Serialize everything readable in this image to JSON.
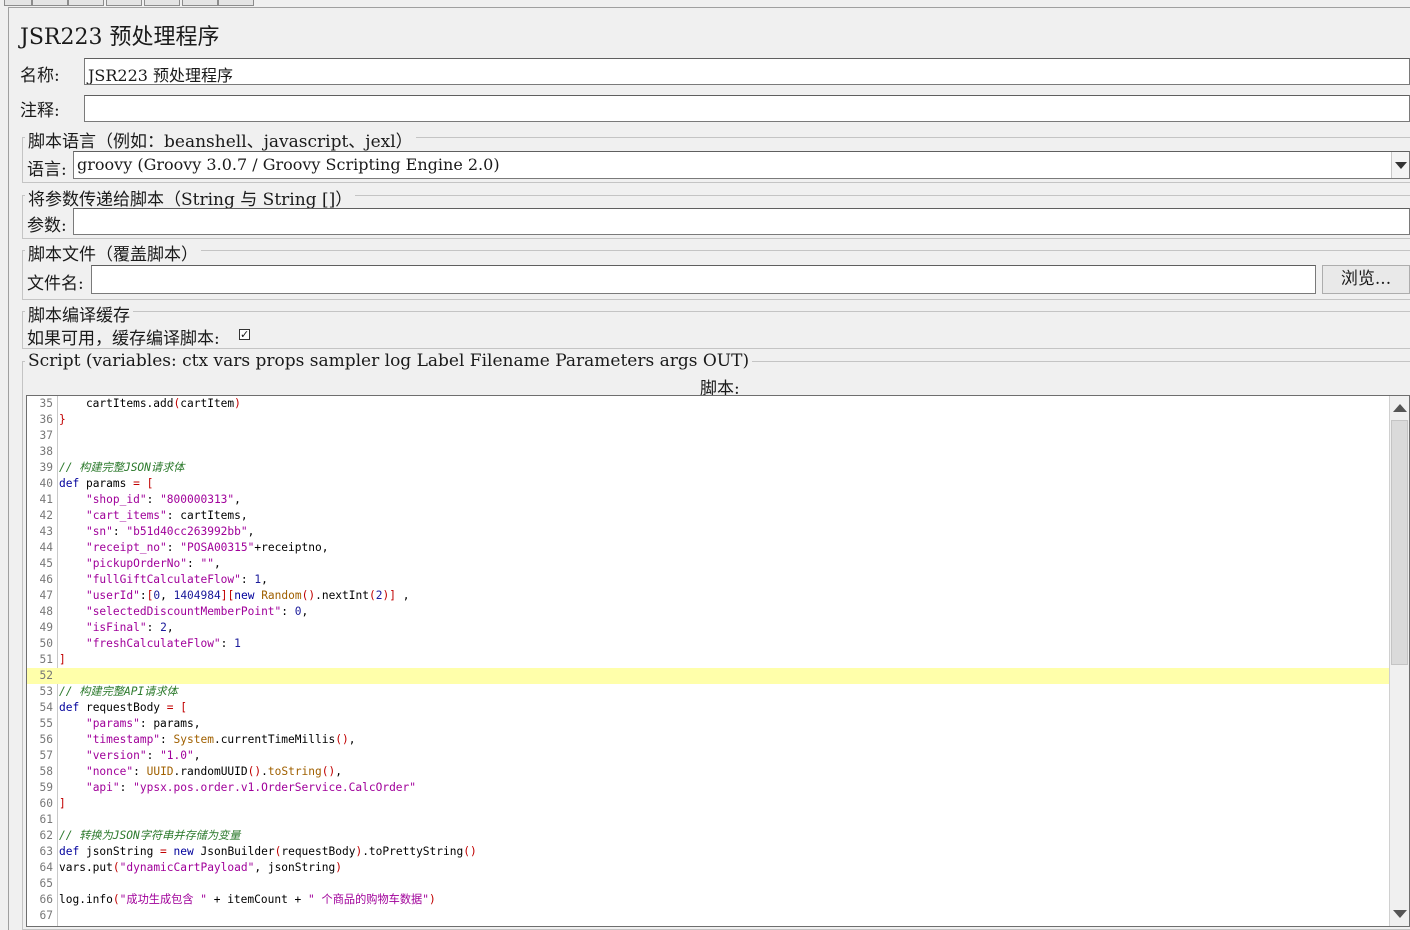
{
  "title": "JSR223 预处理程序",
  "name_label": "名称:",
  "name_value": "JSR223 预处理程序",
  "comment_label": "注释:",
  "comment_value": "",
  "lang_section": "脚本语言（例如：beanshell、javascript、jexl）",
  "lang_label": "语言:",
  "lang_value": "groovy      (Groovy 3.0.7 / Groovy Scripting Engine 2.0)",
  "params_section": "将参数传递给脚本（String 与 String []）",
  "params_label": "参数:",
  "params_value": "",
  "file_section": "脚本文件（覆盖脚本）",
  "file_label": "文件名:",
  "file_value": "",
  "browse_button": "浏览...",
  "cache_section": "脚本编译缓存",
  "cache_label": "如果可用，缓存编译脚本:",
  "cache_checked": true,
  "script_section": "Script (variables: ctx vars props sampler log Label Filename Parameters args OUT)",
  "script_caption": "脚本:",
  "highlighted_line": 52,
  "code_lines": [
    {
      "n": "35",
      "tokens": [
        [
          "",
          "    cartItems.add"
        ],
        [
          "br",
          "("
        ],
        [
          "",
          "cartItem"
        ],
        [
          "br",
          ")"
        ]
      ]
    },
    {
      "n": "36",
      "tokens": [
        [
          "br",
          "}"
        ]
      ]
    },
    {
      "n": "37",
      "tokens": []
    },
    {
      "n": "38",
      "tokens": []
    },
    {
      "n": "39",
      "tokens": [
        [
          "cm",
          "// 构建完整JSON请求体"
        ]
      ]
    },
    {
      "n": "40",
      "tokens": [
        [
          "kw",
          "def"
        ],
        [
          "",
          " params "
        ],
        [
          "br",
          "="
        ],
        [
          "",
          " "
        ],
        [
          "br",
          "["
        ]
      ]
    },
    {
      "n": "41",
      "tokens": [
        [
          "",
          "    "
        ],
        [
          "str",
          "\"shop_id\""
        ],
        [
          "",
          ": "
        ],
        [
          "str",
          "\"800000313\""
        ],
        [
          "",
          ","
        ]
      ]
    },
    {
      "n": "42",
      "tokens": [
        [
          "",
          "    "
        ],
        [
          "str",
          "\"cart_items\""
        ],
        [
          "",
          ": cartItems,"
        ]
      ]
    },
    {
      "n": "43",
      "tokens": [
        [
          "",
          "    "
        ],
        [
          "str",
          "\"sn\""
        ],
        [
          "",
          ": "
        ],
        [
          "str",
          "\"b51d40cc263992bb\""
        ],
        [
          "",
          ","
        ]
      ]
    },
    {
      "n": "44",
      "tokens": [
        [
          "",
          "    "
        ],
        [
          "str",
          "\"receipt_no\""
        ],
        [
          "",
          ": "
        ],
        [
          "str",
          "\"POSA00315\""
        ],
        [
          "",
          "+receiptno,"
        ]
      ]
    },
    {
      "n": "45",
      "tokens": [
        [
          "",
          "    "
        ],
        [
          "str",
          "\"pickupOrderNo\""
        ],
        [
          "",
          ": "
        ],
        [
          "str",
          "\"\""
        ],
        [
          "",
          ","
        ]
      ]
    },
    {
      "n": "46",
      "tokens": [
        [
          "",
          "    "
        ],
        [
          "str",
          "\"fullGiftCalculateFlow\""
        ],
        [
          "",
          ": "
        ],
        [
          "num",
          "1"
        ],
        [
          "",
          ","
        ]
      ]
    },
    {
      "n": "47",
      "tokens": [
        [
          "",
          "    "
        ],
        [
          "str",
          "\"userId\""
        ],
        [
          "",
          ":"
        ],
        [
          "br",
          "["
        ],
        [
          "num",
          "0"
        ],
        [
          "",
          ", "
        ],
        [
          "num",
          "1404984"
        ],
        [
          "br",
          "]["
        ],
        [
          "kw",
          "new"
        ],
        [
          "",
          " "
        ],
        [
          "fn",
          "Random"
        ],
        [
          "br",
          "()"
        ],
        [
          "",
          ".nextInt"
        ],
        [
          "br",
          "("
        ],
        [
          "num",
          "2"
        ],
        [
          "br",
          ")]"
        ],
        [
          "",
          " ,"
        ]
      ]
    },
    {
      "n": "48",
      "tokens": [
        [
          "",
          "    "
        ],
        [
          "str",
          "\"selectedDiscountMemberPoint\""
        ],
        [
          "",
          ": "
        ],
        [
          "num",
          "0"
        ],
        [
          "",
          ","
        ]
      ]
    },
    {
      "n": "49",
      "tokens": [
        [
          "",
          "    "
        ],
        [
          "str",
          "\"isFinal\""
        ],
        [
          "",
          ": "
        ],
        [
          "num",
          "2"
        ],
        [
          "",
          ","
        ]
      ]
    },
    {
      "n": "50",
      "tokens": [
        [
          "",
          "    "
        ],
        [
          "str",
          "\"freshCalculateFlow\""
        ],
        [
          "",
          ": "
        ],
        [
          "num",
          "1"
        ]
      ]
    },
    {
      "n": "51",
      "tokens": [
        [
          "br",
          "]"
        ]
      ]
    },
    {
      "n": "52",
      "tokens": []
    },
    {
      "n": "53",
      "tokens": [
        [
          "cm",
          "// 构建完整API请求体"
        ]
      ]
    },
    {
      "n": "54",
      "tokens": [
        [
          "kw",
          "def"
        ],
        [
          "",
          " requestBody "
        ],
        [
          "br",
          "="
        ],
        [
          "",
          " "
        ],
        [
          "br",
          "["
        ]
      ]
    },
    {
      "n": "55",
      "tokens": [
        [
          "",
          "    "
        ],
        [
          "str",
          "\"params\""
        ],
        [
          "",
          ": params,"
        ]
      ]
    },
    {
      "n": "56",
      "tokens": [
        [
          "",
          "    "
        ],
        [
          "str",
          "\"timestamp\""
        ],
        [
          "",
          ": "
        ],
        [
          "fn",
          "System"
        ],
        [
          "",
          ".currentTimeMillis"
        ],
        [
          "br",
          "()"
        ],
        [
          "",
          ","
        ]
      ]
    },
    {
      "n": "57",
      "tokens": [
        [
          "",
          "    "
        ],
        [
          "str",
          "\"version\""
        ],
        [
          "",
          ": "
        ],
        [
          "str",
          "\"1.0\""
        ],
        [
          "",
          ","
        ]
      ]
    },
    {
      "n": "58",
      "tokens": [
        [
          "",
          "    "
        ],
        [
          "str",
          "\"nonce\""
        ],
        [
          "",
          ": "
        ],
        [
          "fn",
          "UUID"
        ],
        [
          "",
          ".randomUUID"
        ],
        [
          "br",
          "()"
        ],
        [
          "",
          "."
        ],
        [
          "fn",
          "toString"
        ],
        [
          "br",
          "()"
        ],
        [
          "",
          ","
        ]
      ]
    },
    {
      "n": "59",
      "tokens": [
        [
          "",
          "    "
        ],
        [
          "str",
          "\"api\""
        ],
        [
          "",
          ": "
        ],
        [
          "str",
          "\"ypsx.pos.order.v1.OrderService.CalcOrder\""
        ]
      ]
    },
    {
      "n": "60",
      "tokens": [
        [
          "br",
          "]"
        ]
      ]
    },
    {
      "n": "61",
      "tokens": []
    },
    {
      "n": "62",
      "tokens": [
        [
          "cm",
          "// 转换为JSON字符串并存储为变量"
        ]
      ]
    },
    {
      "n": "63",
      "tokens": [
        [
          "kw",
          "def"
        ],
        [
          "",
          " jsonString "
        ],
        [
          "br",
          "="
        ],
        [
          "",
          " "
        ],
        [
          "kw",
          "new"
        ],
        [
          "",
          " JsonBuilder"
        ],
        [
          "br",
          "("
        ],
        [
          "",
          "requestBody"
        ],
        [
          "br",
          ")"
        ],
        [
          "",
          ".toPrettyString"
        ],
        [
          "br",
          "()"
        ]
      ]
    },
    {
      "n": "64",
      "tokens": [
        [
          "",
          "vars.put"
        ],
        [
          "br",
          "("
        ],
        [
          "str",
          "\"dynamicCartPayload\""
        ],
        [
          "",
          ", jsonString"
        ],
        [
          "br",
          ")"
        ]
      ]
    },
    {
      "n": "65",
      "tokens": []
    },
    {
      "n": "66",
      "tokens": [
        [
          "",
          "log.info"
        ],
        [
          "br",
          "("
        ],
        [
          "str",
          "\"成功生成包含 \""
        ],
        [
          "",
          " + itemCount + "
        ],
        [
          "str",
          "\" 个商品的购物车数据\""
        ],
        [
          "br",
          ")"
        ]
      ]
    },
    {
      "n": "67",
      "tokens": []
    }
  ]
}
